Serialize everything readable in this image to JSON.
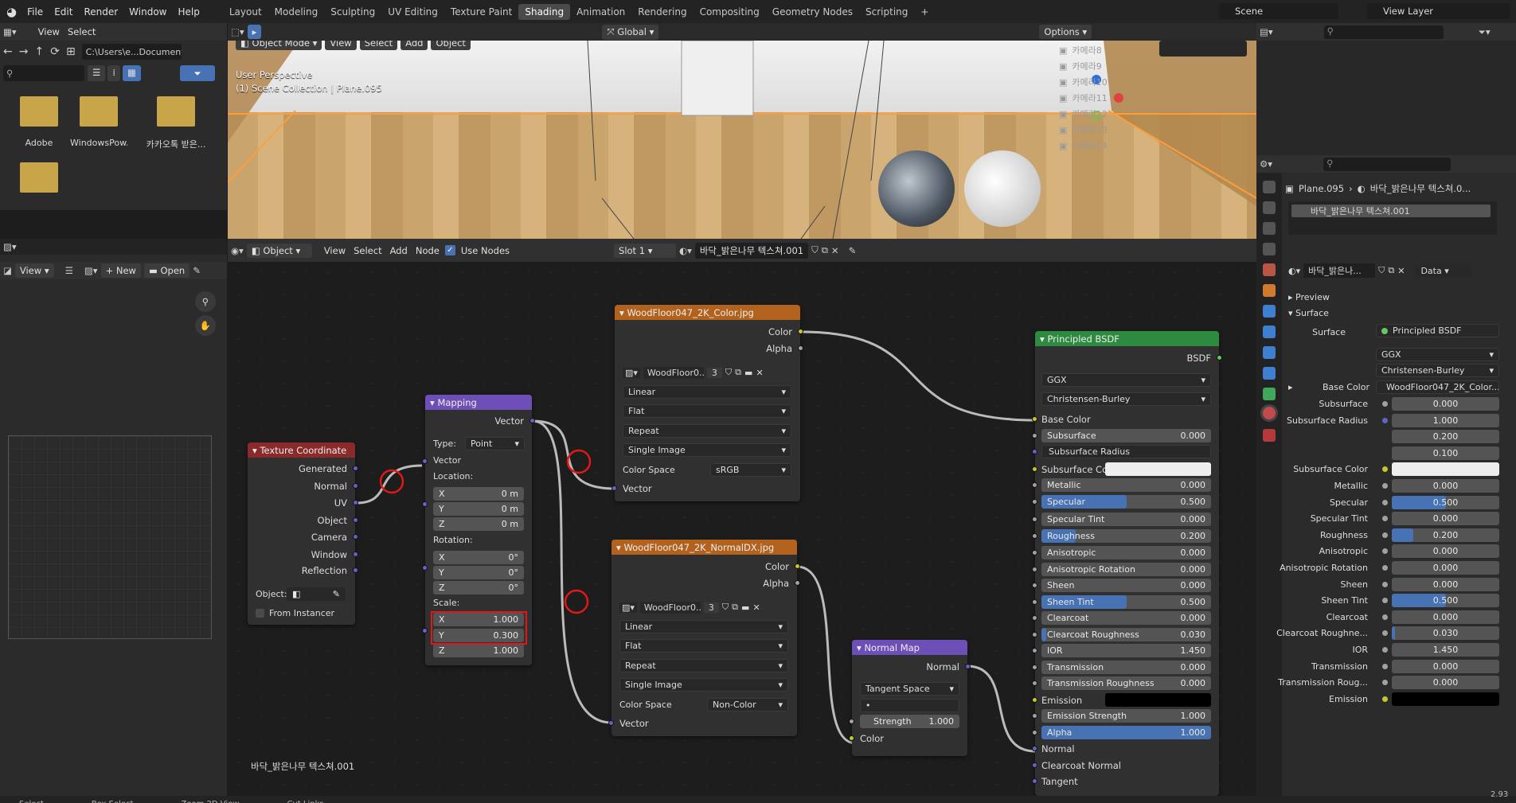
{
  "top_menu": [
    "File",
    "Edit",
    "Render",
    "Window",
    "Help"
  ],
  "workspaces": [
    "Layout",
    "Modeling",
    "Sculpting",
    "UV Editing",
    "Texture Paint",
    "Shading",
    "Animation",
    "Rendering",
    "Compositing",
    "Geometry Nodes",
    "Scripting"
  ],
  "active_workspace": "Shading",
  "scene_name": "Scene",
  "view_layer": "View Layer",
  "file_browser": {
    "menu": [
      "View",
      "Select"
    ],
    "path": "C:\\Users\\e...Documents\\",
    "folders": [
      "Adobe",
      "WindowsPow...",
      "카카오톡 받은...",
      ""
    ]
  },
  "viewport": {
    "mode": "Object Mode",
    "menu": [
      "View",
      "Select",
      "Add",
      "Object"
    ],
    "orientation": "Global",
    "options": "Options",
    "overlay_title": "User Perspective",
    "overlay_sub": "(1) Scene Collection | Plane.095"
  },
  "outliner": {
    "items": [
      "카메라8",
      "카메라9",
      "카메라10",
      "카메라11",
      "카메라12",
      "카메라13",
      "카메라14"
    ]
  },
  "image_editor": {
    "view": "View",
    "new": "New",
    "open": "Open"
  },
  "node_editor": {
    "object": "Object",
    "menu": [
      "View",
      "Select",
      "Add",
      "Node"
    ],
    "use_nodes": "Use Nodes",
    "slot": "Slot 1",
    "material": "바닥_밝은나무 텍스쳐.001",
    "footer_label": "바닥_밝은나무 텍스쳐.001"
  },
  "nodes": {
    "texcoord": {
      "title": "Texture Coordinate",
      "outputs": [
        "Generated",
        "Normal",
        "UV",
        "Object",
        "Camera",
        "Window",
        "Reflection"
      ],
      "object_label": "Object:",
      "from_instancer": "From Instancer"
    },
    "mapping": {
      "title": "Mapping",
      "output": "Vector",
      "type_label": "Type:",
      "type_value": "Point",
      "vector": "Vector",
      "location": "Location:",
      "rotation": "Rotation:",
      "scale": "Scale:",
      "loc": [
        [
          "X",
          "0 m"
        ],
        [
          "Y",
          "0 m"
        ],
        [
          "Z",
          "0 m"
        ]
      ],
      "rot": [
        [
          "X",
          "0°"
        ],
        [
          "Y",
          "0°"
        ],
        [
          "Z",
          "0°"
        ]
      ],
      "scl": [
        [
          "X",
          "1.000"
        ],
        [
          "Y",
          "0.300"
        ],
        [
          "Z",
          "1.000"
        ]
      ]
    },
    "color_tex": {
      "title": "WoodFloor047_2K_Color.jpg",
      "outputs": [
        "Color",
        "Alpha"
      ],
      "image": "WoodFloor0...",
      "users": "3",
      "interp": "Linear",
      "proj": "Flat",
      "ext": "Repeat",
      "source": "Single Image",
      "cs_label": "Color Space",
      "cs_value": "sRGB",
      "input": "Vector"
    },
    "normal_tex": {
      "title": "WoodFloor047_2K_NormalDX.jpg",
      "outputs": [
        "Color",
        "Alpha"
      ],
      "image": "WoodFloor0...",
      "users": "3",
      "interp": "Linear",
      "proj": "Flat",
      "ext": "Repeat",
      "source": "Single Image",
      "cs_label": "Color Space",
      "cs_value": "Non-Color",
      "input": "Vector"
    },
    "normal_map": {
      "title": "Normal Map",
      "output": "Normal",
      "space": "Tangent Space",
      "uv": "•",
      "strength_label": "Strength",
      "strength": "1.000",
      "input": "Color"
    },
    "bsdf": {
      "title": "Principled BSDF",
      "output": "BSDF",
      "dist": "GGX",
      "sss": "Christensen-Burley",
      "rows": [
        [
          "Base Color",
          ""
        ],
        [
          "Subsurface",
          "0.000"
        ],
        [
          "Subsurface Radius",
          ""
        ],
        [
          "Subsurface Col...",
          ""
        ],
        [
          "Metallic",
          "0.000"
        ],
        [
          "Specular",
          "0.500"
        ],
        [
          "Specular Tint",
          "0.000"
        ],
        [
          "Roughness",
          "0.200"
        ],
        [
          "Anisotropic",
          "0.000"
        ],
        [
          "Anisotropic Rotation",
          "0.000"
        ],
        [
          "Sheen",
          "0.000"
        ],
        [
          "Sheen Tint",
          "0.500"
        ],
        [
          "Clearcoat",
          "0.000"
        ],
        [
          "Clearcoat Roughness",
          "0.030"
        ],
        [
          "IOR",
          "1.450"
        ],
        [
          "Transmission",
          "0.000"
        ],
        [
          "Transmission Roughness",
          "0.000"
        ],
        [
          "Emission",
          ""
        ],
        [
          "Emission Strength",
          "1.000"
        ],
        [
          "Alpha",
          "1.000"
        ],
        [
          "Normal",
          ""
        ],
        [
          "Clearcoat Normal",
          ""
        ],
        [
          "Tangent",
          ""
        ]
      ]
    }
  },
  "properties": {
    "object": "Plane.095",
    "material_short": "바닥_밝은나무 텍스쳐.0...",
    "slot_material": "바닥_밝은나무 텍스쳐.001",
    "mat_field": "바닥_밝은나...",
    "data": "Data",
    "preview": "Preview",
    "surface": "Surface",
    "surface_label": "Surface",
    "surface_value": "Principled BSDF",
    "dist": "GGX",
    "sss": "Christensen-Burley",
    "base_color_label": "Base Color",
    "base_color_value": "WoodFloor047_2K_Color...",
    "rows": [
      [
        "Subsurface",
        "0.000"
      ],
      [
        "Subsurface Radius",
        "1.000"
      ],
      [
        "",
        "0.200"
      ],
      [
        "",
        "0.100"
      ],
      [
        "Subsurface Color",
        ""
      ],
      [
        "Metallic",
        "0.000"
      ],
      [
        "Specular",
        "0.500"
      ],
      [
        "Specular Tint",
        "0.000"
      ],
      [
        "Roughness",
        "0.200"
      ],
      [
        "Anisotropic",
        "0.000"
      ],
      [
        "Anisotropic Rotation",
        "0.000"
      ],
      [
        "Sheen",
        "0.000"
      ],
      [
        "Sheen Tint",
        "0.500"
      ],
      [
        "Clearcoat",
        "0.000"
      ],
      [
        "Clearcoat Roughne...",
        "0.030"
      ],
      [
        "IOR",
        "1.450"
      ],
      [
        "Transmission",
        "0.000"
      ],
      [
        "Transmission Roug...",
        "0.000"
      ],
      [
        "Emission",
        ""
      ]
    ]
  },
  "status_bar": [
    "Select",
    "Box Select",
    "Zoom 2D View",
    "Cut Links"
  ],
  "version": "2.93"
}
